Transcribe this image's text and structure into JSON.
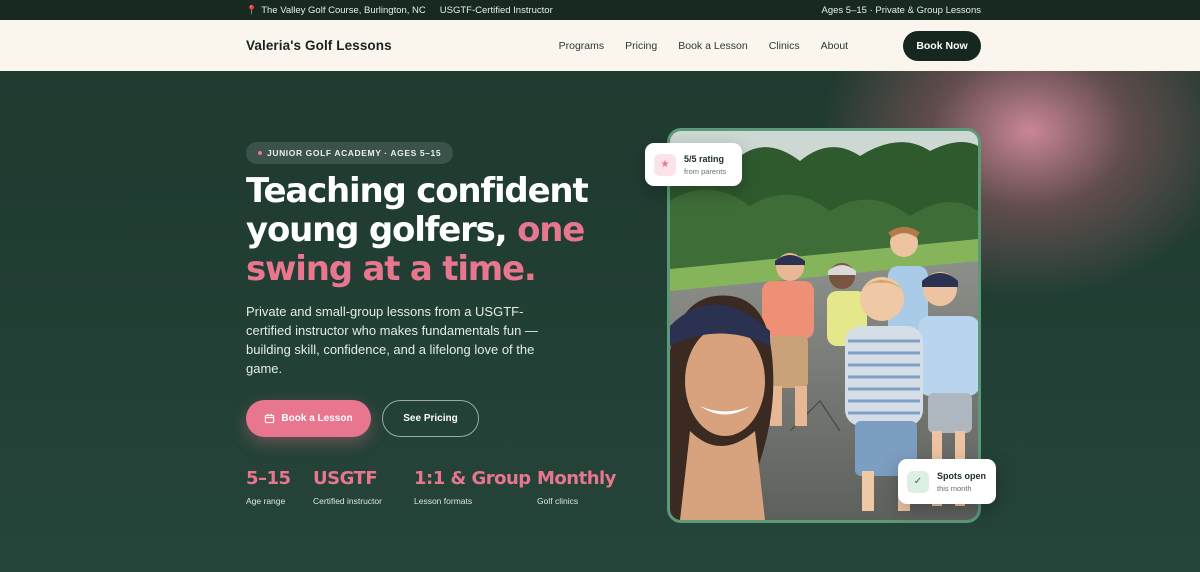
{
  "topbar": {
    "location": "The Valley Golf Course, Burlington, NC",
    "cert": "USGTF-Certified Instructor",
    "right": "Ages 5–15 · Private & Group Lessons"
  },
  "nav": {
    "brand": "Valeria's Golf Lessons",
    "items": [
      "Programs",
      "Pricing",
      "Book a Lesson",
      "Clinics",
      "About"
    ],
    "cta": "Book Now"
  },
  "hero": {
    "badge": "JUNIOR GOLF ACADEMY · AGES 5–15",
    "headline_a": "Teaching confident young golfers,",
    "headline_b": "one swing at a time.",
    "subtext": "Private and small-group lessons from a USGTF-certified instructor who makes fundamentals fun — building skill, confidence, and a lifelong love of the game.",
    "primary_cta": "Book a Lesson",
    "secondary_cta": "See Pricing",
    "stats": [
      {
        "value": "5–15",
        "label": "Age range"
      },
      {
        "value": "USGTF",
        "label": "Certified instructor"
      },
      {
        "value": "1:1 & Group",
        "label": "Lesson formats"
      },
      {
        "value": "Monthly",
        "label": "Golf clinics"
      }
    ]
  },
  "cards": {
    "rating_title": "5/5 rating",
    "rating_sub": "from parents",
    "spots_title": "Spots open",
    "spots_sub": "this month"
  },
  "icons": {
    "pin": "map-pin-icon",
    "calendar": "calendar-icon",
    "star": "star-icon",
    "check": "check-icon"
  },
  "colors": {
    "accent": "#e8768f",
    "dark": "#16271f",
    "hero_bg": "#1f3b30",
    "nav_bg": "#faf6ee"
  }
}
